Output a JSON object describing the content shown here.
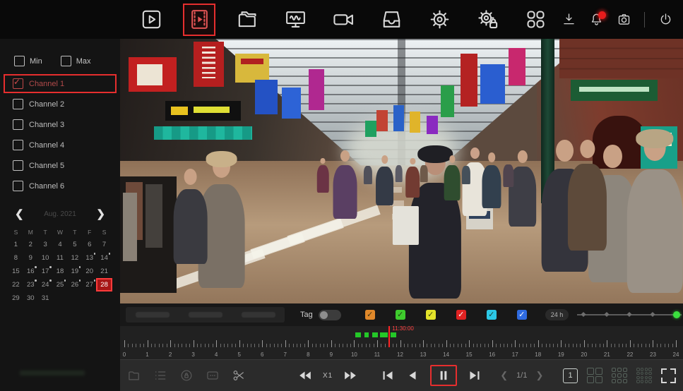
{
  "topbar": {
    "main_icons": [
      {
        "name": "live-view",
        "selected": false
      },
      {
        "name": "playback",
        "selected": true
      },
      {
        "name": "file-manager",
        "selected": false
      },
      {
        "name": "display",
        "selected": false
      },
      {
        "name": "channel",
        "selected": false
      },
      {
        "name": "backup",
        "selected": false
      },
      {
        "name": "settings",
        "selected": false
      },
      {
        "name": "system-settings",
        "selected": false
      },
      {
        "name": "apps",
        "selected": false
      }
    ],
    "right_icons": [
      {
        "name": "download"
      },
      {
        "name": "alarm",
        "has_badge": true
      },
      {
        "name": "snapshot"
      },
      {
        "name": "power"
      }
    ]
  },
  "sidebar": {
    "min_label": "Min",
    "max_label": "Max",
    "channels": [
      {
        "label": "Channel 1",
        "checked": true,
        "highlighted": true
      },
      {
        "label": "Channel 2",
        "checked": false
      },
      {
        "label": "Channel 3",
        "checked": false
      },
      {
        "label": "Channel 4",
        "checked": false
      },
      {
        "label": "Channel 5",
        "checked": false
      },
      {
        "label": "Channel 6",
        "checked": false
      }
    ],
    "calendar": {
      "month_label": "Aug. 2021",
      "weekdays": [
        "S",
        "M",
        "T",
        "W",
        "T",
        "F",
        "S"
      ],
      "num_days": 31,
      "first_weekday": 0,
      "selected_day": 28,
      "marked_days": [
        13,
        14,
        16,
        17,
        19,
        23,
        24,
        25,
        26,
        27
      ]
    }
  },
  "filterbar": {
    "tag_label": "Tag",
    "tag_enabled": false,
    "record_types": [
      {
        "name": "normal",
        "color": "#e0882a",
        "checked": true
      },
      {
        "name": "motion",
        "color": "#3ecb2d",
        "checked": true
      },
      {
        "name": "smart",
        "color": "#e3e32a",
        "checked": true
      },
      {
        "name": "alarm",
        "color": "#e02222",
        "checked": true
      },
      {
        "name": "intelligent",
        "color": "#2cc8e6",
        "checked": true
      },
      {
        "name": "other",
        "color": "#2f6be0",
        "checked": true
      }
    ],
    "range_label": "24 h"
  },
  "timeline": {
    "hour_labels": [
      "0",
      "1",
      "2",
      "3",
      "4",
      "5",
      "6",
      "7",
      "8",
      "9",
      "10",
      "11",
      "12",
      "13",
      "14",
      "15",
      "16",
      "17",
      "18",
      "19",
      "20",
      "21",
      "22",
      "23",
      "24"
    ],
    "segments": [
      {
        "start": 10.05,
        "end": 10.28
      },
      {
        "start": 10.45,
        "end": 10.62
      },
      {
        "start": 10.8,
        "end": 11.02
      },
      {
        "start": 11.12,
        "end": 11.46
      },
      {
        "start": 11.6,
        "end": 11.82
      }
    ],
    "playhead": {
      "hour": 11.5,
      "label": "11:30:00"
    }
  },
  "controls": {
    "left_icons": [
      "open-file",
      "record-list",
      "lock-record",
      "watermark",
      "clip"
    ],
    "speed_label": "X1",
    "page_label": "1/1",
    "view_single_label": "1"
  },
  "colors": {
    "accent_red": "#e62e2e",
    "segment_green": "#24c828",
    "slider_knob_green": "#3ae03e"
  }
}
